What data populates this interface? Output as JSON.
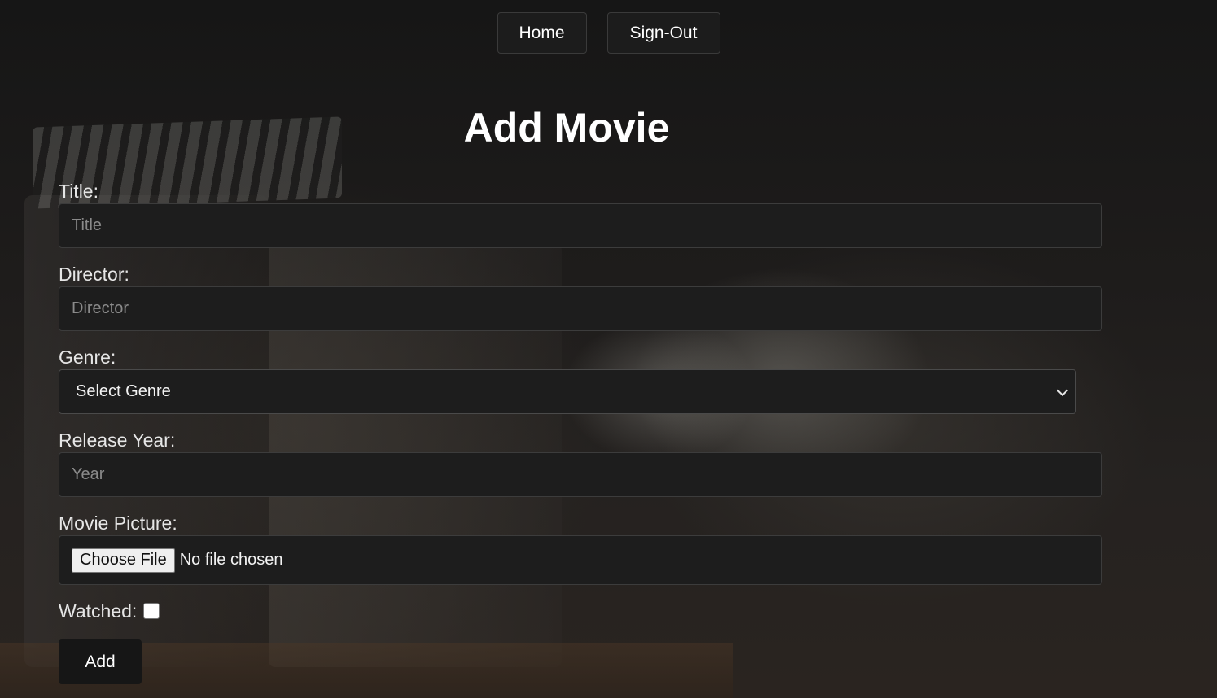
{
  "nav": {
    "home_label": "Home",
    "signout_label": "Sign-Out"
  },
  "page": {
    "title": "Add Movie"
  },
  "form": {
    "title": {
      "label": "Title:",
      "placeholder": "Title",
      "value": ""
    },
    "director": {
      "label": "Director:",
      "placeholder": "Director",
      "value": ""
    },
    "genre": {
      "label": "Genre:",
      "selected": "Select Genre"
    },
    "release_year": {
      "label": "Release Year:",
      "placeholder": "Year",
      "value": ""
    },
    "picture": {
      "label": "Movie Picture:",
      "button_label": "Choose File",
      "status": "No file chosen"
    },
    "watched": {
      "label": "Watched:",
      "checked": false
    },
    "submit_label": "Add"
  },
  "colors": {
    "background": "#1b1a19",
    "input_bg": "#1d1d1d",
    "text": "#ffffff"
  }
}
